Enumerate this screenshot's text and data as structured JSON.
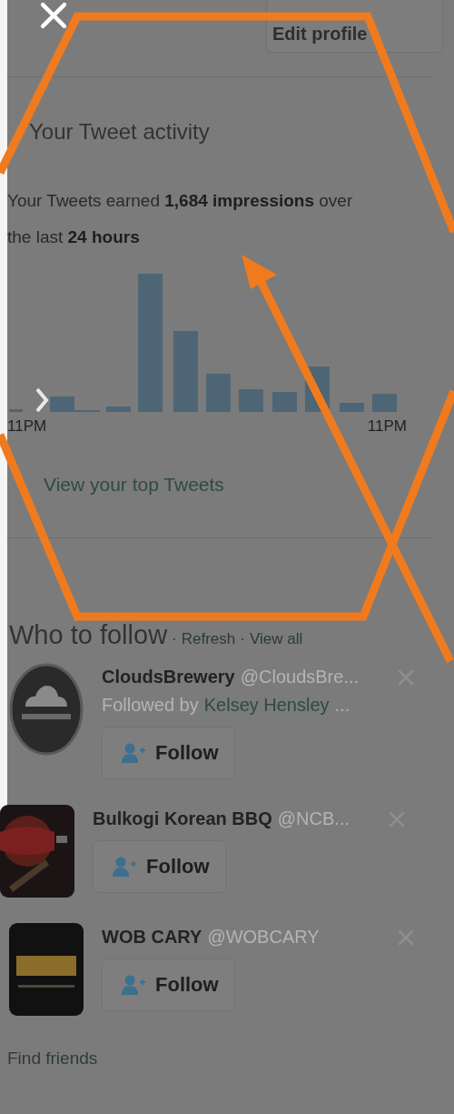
{
  "top_bar": {
    "edit_button": "Edit profile"
  },
  "activity": {
    "title": "Your Tweet activity",
    "summary": "Your Tweets earned **1,684 impressions** over the last **24 hours**",
    "axis_labels": [
      "11PM",
      "11PM"
    ],
    "link": "View your top Tweets"
  },
  "who_to_follow": {
    "title": "Who to follow",
    "links": [
      {
        "prefix": "·",
        "label": "Refresh"
      },
      {
        "prefix": "·",
        "label": "View all"
      }
    ],
    "accounts": [
      {
        "name": "CloudsBrewery",
        "handle": "@CloudsBre...",
        "followed_by": {
          "prefix": "Followed by",
          "names": "Kelsey Hensley",
          "suffix": "..."
        },
        "button": "Follow"
      },
      {
        "name": "Bulkogi Korean BBQ",
        "handle": "@NCB...",
        "button": "Follow"
      },
      {
        "name": "WOB CARY",
        "handle": "@WOBCARY",
        "button": "Follow"
      }
    ],
    "footer_link": "Find friends"
  }
}
